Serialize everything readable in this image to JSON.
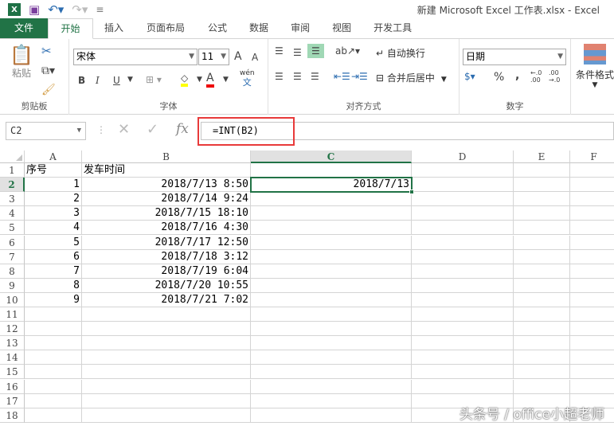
{
  "window": {
    "title": "新建 Microsoft Excel 工作表.xlsx - Excel",
    "app_icon": "X"
  },
  "tabs": [
    "文件",
    "开始",
    "插入",
    "页面布局",
    "公式",
    "数据",
    "审阅",
    "视图",
    "开发工具"
  ],
  "ribbon": {
    "clipboard": {
      "label": "剪贴板",
      "paste": "粘贴"
    },
    "font": {
      "label": "字体",
      "font_name": "宋体",
      "font_size": "11",
      "bold": "B",
      "italic": "I",
      "underline": "U",
      "grow": "A",
      "shrink": "A",
      "font_color": "A",
      "phonetic_top": "wén",
      "phonetic_bottom": "文"
    },
    "alignment": {
      "label": "对齐方式",
      "wrap": "自动换行",
      "merge": "合并后居中"
    },
    "number": {
      "label": "数字",
      "format": "日期",
      "percent": "%",
      "comma": ",",
      "inc_decimal": "←.0 .00",
      "dec_decimal": ".00 →.0"
    },
    "styles": {
      "conditional": "条件格式"
    }
  },
  "formula_bar": {
    "name_box": "C2",
    "fx": "fx",
    "formula": "=INT(B2)"
  },
  "columns": [
    "A",
    "B",
    "C",
    "D",
    "E",
    "F"
  ],
  "rows": [
    "1",
    "2",
    "3",
    "4",
    "5",
    "6",
    "7",
    "8",
    "9",
    "10",
    "11",
    "12",
    "13",
    "14",
    "15",
    "16",
    "17",
    "18"
  ],
  "cells": {
    "header": {
      "A": "序号",
      "B": "发车时间"
    },
    "data": [
      {
        "A": "1",
        "B": "2018/7/13 8:50",
        "C": "2018/7/13"
      },
      {
        "A": "2",
        "B": "2018/7/14 9:24"
      },
      {
        "A": "3",
        "B": "2018/7/15 18:10"
      },
      {
        "A": "4",
        "B": "2018/7/16 4:30"
      },
      {
        "A": "5",
        "B": "2018/7/17 12:50"
      },
      {
        "A": "6",
        "B": "2018/7/18 3:12"
      },
      {
        "A": "7",
        "B": "2018/7/19 6:04"
      },
      {
        "A": "8",
        "B": "2018/7/20 10:55"
      },
      {
        "A": "9",
        "B": "2018/7/21 7:02"
      }
    ]
  },
  "watermark": "头条号 / office小超老师"
}
